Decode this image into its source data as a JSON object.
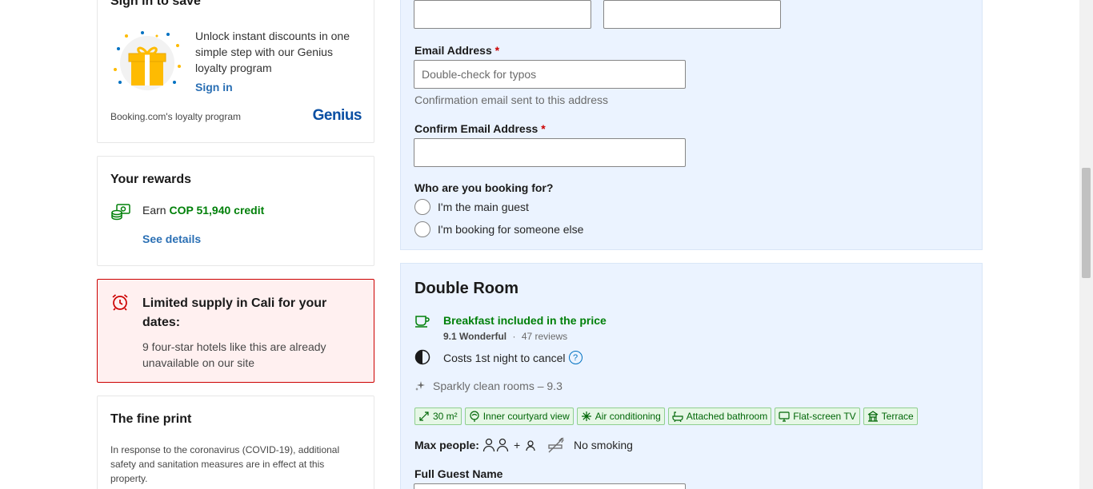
{
  "genius": {
    "title": "Sign in to save",
    "description": "Unlock instant discounts in one simple step with our Genius loyalty program",
    "sign_in": "Sign in",
    "footer": "Booking.com's loyalty program",
    "logo": "Genius"
  },
  "rewards": {
    "title": "Your rewards",
    "earn_prefix": "Earn",
    "earn_amount": "COP 51,940 credit",
    "see_details": "See details"
  },
  "limited": {
    "title": "Limited supply in Cali for your dates:",
    "text": "9 four-star hotels like this are already unavailable on our site"
  },
  "fine_print": {
    "title": "The fine print",
    "text": "In response to the coronavirus (COVID-19), additional safety and sanitation measures are in effect at this property."
  },
  "form": {
    "email_label": "Email Address",
    "email_placeholder": "Double-check for typos",
    "email_hint": "Confirmation email sent to this address",
    "confirm_email_label": "Confirm Email Address",
    "required_mark": "*",
    "booking_for_label": "Who are you booking for?",
    "options": [
      "I'm the main guest",
      "I'm booking for someone else"
    ]
  },
  "room": {
    "title": "Double Room",
    "breakfast": "Breakfast included in the price",
    "score": "9.1 Wonderful",
    "score_sep": "·",
    "reviews": "47 reviews",
    "cancel": "Costs 1st night to cancel",
    "cancel_help": "?",
    "sparkly": "Sparkly clean rooms – 9.3",
    "facilities": [
      {
        "icon": "size-icon",
        "label": "30 m²"
      },
      {
        "icon": "courtyard-icon",
        "label": "Inner courtyard view"
      },
      {
        "icon": "snowflake-icon",
        "label": "Air conditioning"
      },
      {
        "icon": "bath-icon",
        "label": "Attached bathroom"
      },
      {
        "icon": "tv-icon",
        "label": "Flat-screen TV"
      },
      {
        "icon": "terrace-icon",
        "label": "Terrace"
      }
    ],
    "max_people_label": "Max people:",
    "plus": "+",
    "no_smoking": "No smoking",
    "full_guest_name_label": "Full Guest Name"
  },
  "colors": {
    "link": "#2a6fb4",
    "green": "#008009",
    "alert_red": "#cc0000",
    "panel_blue": "#ebf3ff",
    "genius_blue": "#0a4fa3"
  }
}
